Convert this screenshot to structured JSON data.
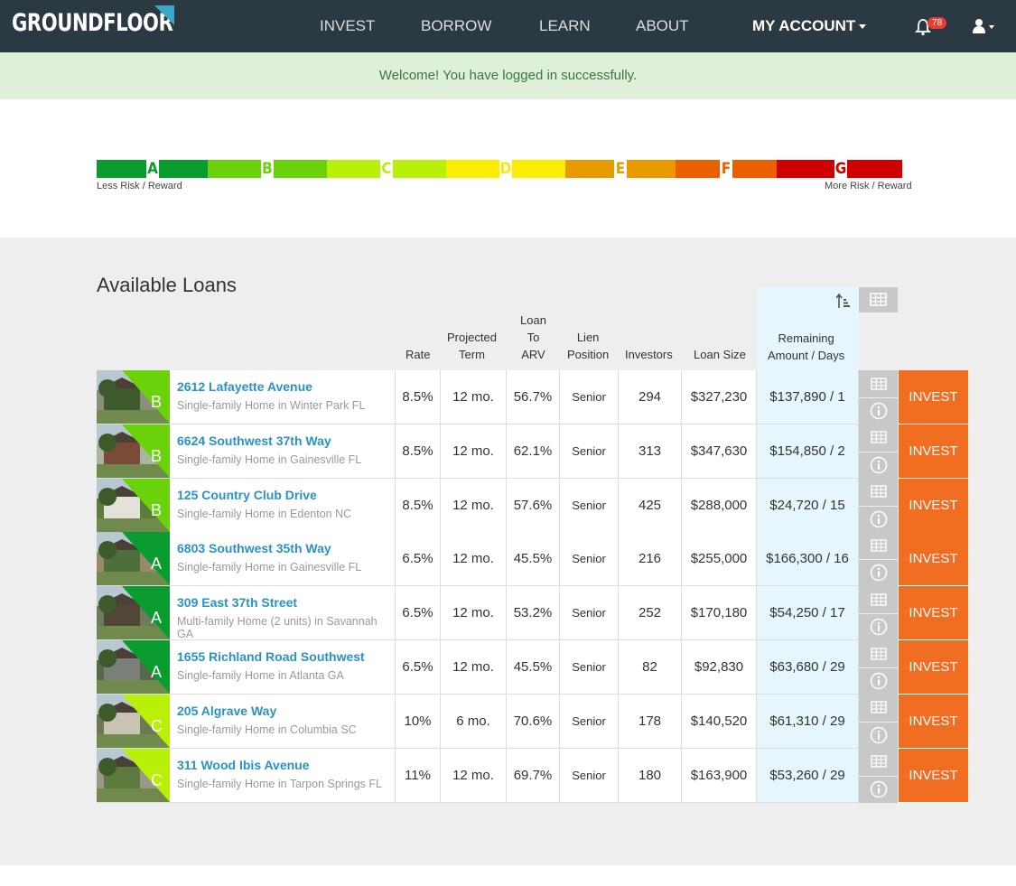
{
  "nav": {
    "logo": "GROUNDFLOOR",
    "links": [
      "INVEST",
      "BORROW",
      "LEARN",
      "ABOUT"
    ],
    "account": "MY ACCOUNT",
    "notifications": "78"
  },
  "alert": "Welcome! You have logged in successfully.",
  "risk": {
    "left_label": "Less Risk / Reward",
    "right_label": "More Risk / Reward",
    "grades": [
      "A",
      "B",
      "C",
      "D",
      "E",
      "F",
      "G"
    ],
    "colors": [
      "#0a9c2f",
      "#6ad20a",
      "#b8f00a",
      "#fbec00",
      "#e99a00",
      "#e96000",
      "#d10000"
    ]
  },
  "title": "Available Loans",
  "headers": {
    "rate": "Rate",
    "term": [
      "Projected",
      "Term"
    ],
    "ltv": [
      "Loan",
      "To",
      "ARV"
    ],
    "lien": [
      "Lien",
      "Position"
    ],
    "investors": "Investors",
    "size": "Loan Size",
    "remaining": [
      "Remaining",
      "Amount / Days"
    ]
  },
  "loans": [
    {
      "grade": "B",
      "address": "2612 Lafayette Avenue",
      "desc": "Single-family Home in Winter Park FL",
      "rate": "8.5%",
      "term": "12 mo.",
      "ltv": "56.7%",
      "lien": "Senior",
      "investors": "294",
      "size": "$327,230",
      "remaining": "$137,890 / 1",
      "action": "INVEST"
    },
    {
      "grade": "B",
      "address": "6624 Southwest 37th Way",
      "desc": "Single-family Home in Gainesville FL",
      "rate": "8.5%",
      "term": "12 mo.",
      "ltv": "62.1%",
      "lien": "Senior",
      "investors": "313",
      "size": "$347,630",
      "remaining": "$154,850 / 2",
      "action": "INVEST"
    },
    {
      "grade": "B",
      "address": "125 Country Club Drive",
      "desc": "Single-family Home in Edenton NC",
      "rate": "8.5%",
      "term": "12 mo.",
      "ltv": "57.6%",
      "lien": "Senior",
      "investors": "425",
      "size": "$288,000",
      "remaining": "$24,720 / 15",
      "action": "INVEST"
    },
    {
      "grade": "A",
      "address": "6803 Southwest 35th Way",
      "desc": "Single-family Home in Gainesville FL",
      "rate": "6.5%",
      "term": "12 mo.",
      "ltv": "45.5%",
      "lien": "Senior",
      "investors": "216",
      "size": "$255,000",
      "remaining": "$166,300 / 16",
      "action": "INVEST"
    },
    {
      "grade": "A",
      "address": "309 East 37th Street",
      "desc": "Multi-family Home (2 units) in Savannah GA",
      "rate": "6.5%",
      "term": "12 mo.",
      "ltv": "53.2%",
      "lien": "Senior",
      "investors": "252",
      "size": "$170,180",
      "remaining": "$54,250 / 17",
      "action": "INVEST"
    },
    {
      "grade": "A",
      "address": "1655 Richland Road Southwest",
      "desc": "Single-family Home in Atlanta GA",
      "rate": "6.5%",
      "term": "12 mo.",
      "ltv": "45.5%",
      "lien": "Senior",
      "investors": "82",
      "size": "$92,830",
      "remaining": "$63,680 / 29",
      "action": "INVEST"
    },
    {
      "grade": "C",
      "address": "205 Algrave Way",
      "desc": "Single-family Home in Columbia SC",
      "rate": "10%",
      "term": "6 mo.",
      "ltv": "70.6%",
      "lien": "Senior",
      "investors": "178",
      "size": "$140,520",
      "remaining": "$61,310 / 29",
      "action": "INVEST"
    },
    {
      "grade": "C",
      "address": "311 Wood Ibis Avenue",
      "desc": "Single-family Home in Tarpon Springs FL",
      "rate": "11%",
      "term": "12 mo.",
      "ltv": "69.7%",
      "lien": "Senior",
      "investors": "180",
      "size": "$163,900",
      "remaining": "$53,260 / 29",
      "action": "INVEST"
    }
  ]
}
